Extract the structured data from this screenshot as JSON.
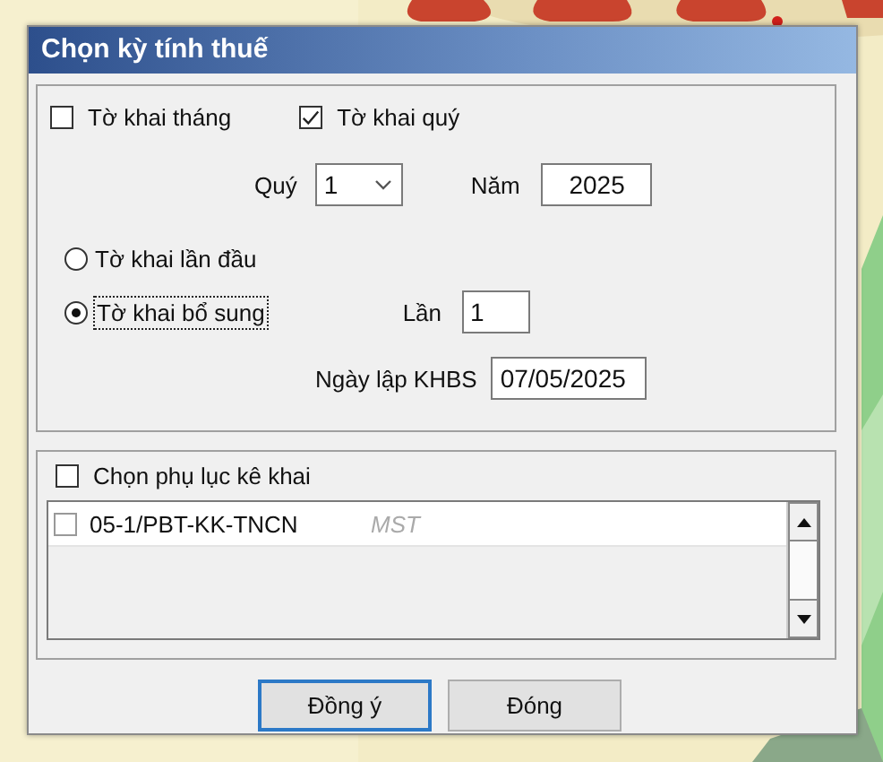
{
  "window": {
    "title": "Chọn kỳ tính thuế"
  },
  "period_types": [
    {
      "label": "Tờ khai tháng",
      "checked": false
    },
    {
      "label": "Tờ khai quý",
      "checked": true
    }
  ],
  "quarter": {
    "label": "Quý",
    "value": "1"
  },
  "year": {
    "label": "Năm",
    "value": "2025"
  },
  "declaration_types": [
    {
      "label": "Tờ khai lần đầu",
      "selected": false,
      "focused": false
    },
    {
      "label": "Tờ khai bổ sung",
      "selected": true,
      "focused": true
    }
  ],
  "revision": {
    "label": "Lần",
    "value": "1"
  },
  "khbs_date": {
    "label": "Ngày lập KHBS",
    "value": "07/05/2025"
  },
  "appendix": {
    "label": "Chọn phụ lục kê khai",
    "checked": false,
    "items": [
      {
        "label": "05-1/PBT-KK-TNCN",
        "column_2": "MST",
        "checked": false
      }
    ]
  },
  "buttons": [
    {
      "label": "Đồng ý",
      "default": true
    },
    {
      "label": "Đóng",
      "default": false
    }
  ]
}
